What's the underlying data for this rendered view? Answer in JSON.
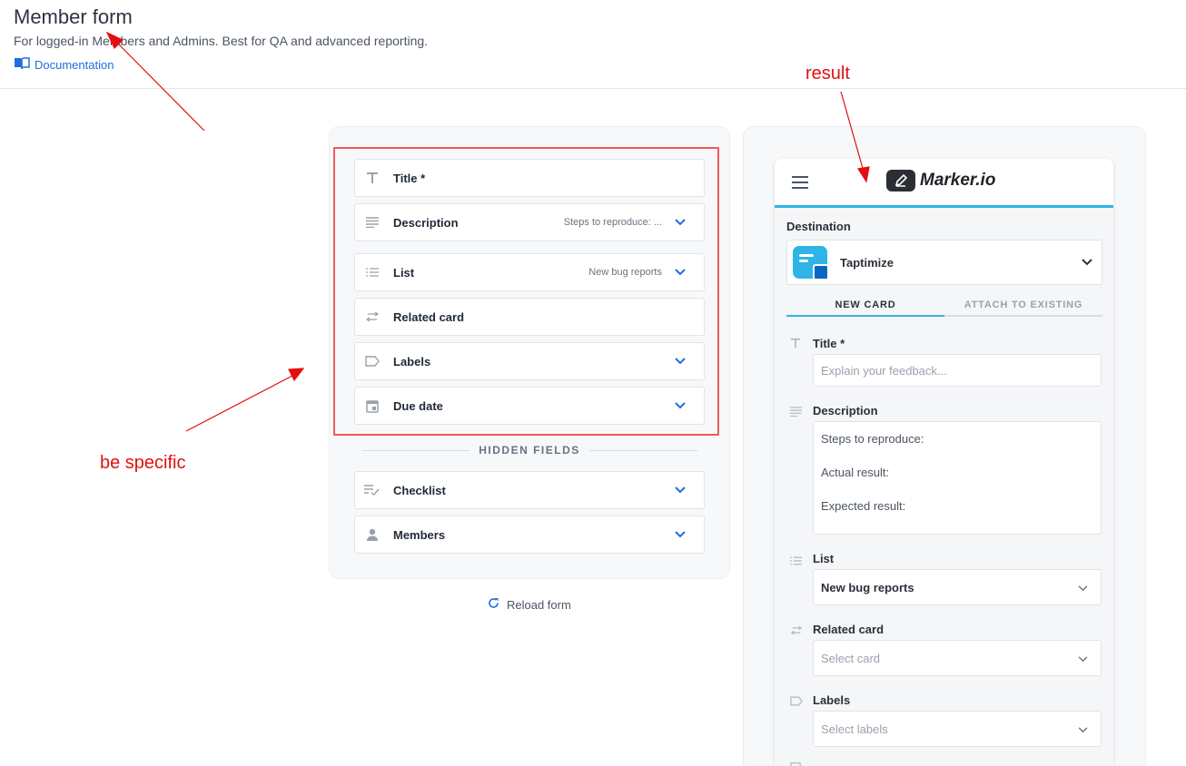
{
  "header": {
    "title": "Member form",
    "subtitle": "For logged-in Members and Admins. Best for QA and advanced reporting.",
    "doc_link": "Documentation"
  },
  "config": {
    "fields": [
      {
        "label": "Title *",
        "value": "",
        "icon": "text-icon",
        "chevron": false
      },
      {
        "label": "Description",
        "value": "Steps to reproduce: ...",
        "icon": "paragraph-icon",
        "chevron": true
      },
      {
        "label": "List",
        "value": "New bug reports",
        "icon": "list-icon",
        "chevron": true
      },
      {
        "label": "Related card",
        "value": "",
        "icon": "swap-arrows-icon",
        "chevron": false
      },
      {
        "label": "Labels",
        "value": "",
        "icon": "label-tag-icon",
        "chevron": true
      },
      {
        "label": "Due date",
        "value": "",
        "icon": "calendar-icon",
        "chevron": true
      }
    ],
    "hidden_divider": "HIDDEN FIELDS",
    "hidden_fields": [
      {
        "label": "Checklist",
        "icon": "checklist-icon",
        "chevron": true
      },
      {
        "label": "Members",
        "icon": "person-icon",
        "chevron": true
      }
    ],
    "reload_label": "Reload form"
  },
  "widget": {
    "brand": "Marker.io",
    "destination_label": "Destination",
    "destination_name": "Taptimize",
    "tabs": [
      "NEW CARD",
      "ATTACH TO EXISTING"
    ],
    "title_label": "Title *",
    "title_placeholder": "Explain your feedback...",
    "description_label": "Description",
    "description_value": "Steps to reproduce:\n\nActual result:\n\nExpected result:",
    "list_label": "List",
    "list_value": "New bug reports",
    "related_label": "Related card",
    "related_placeholder": "Select card",
    "labels_label": "Labels",
    "labels_placeholder": "Select labels"
  },
  "annotations": {
    "result": "result",
    "be_specific": "be specific"
  },
  "colors": {
    "accent": "#1d6fe0",
    "brand_blue": "#2fb4e6",
    "annotation_red": "#e20f0f",
    "highlight_border": "#ef5a5a"
  }
}
